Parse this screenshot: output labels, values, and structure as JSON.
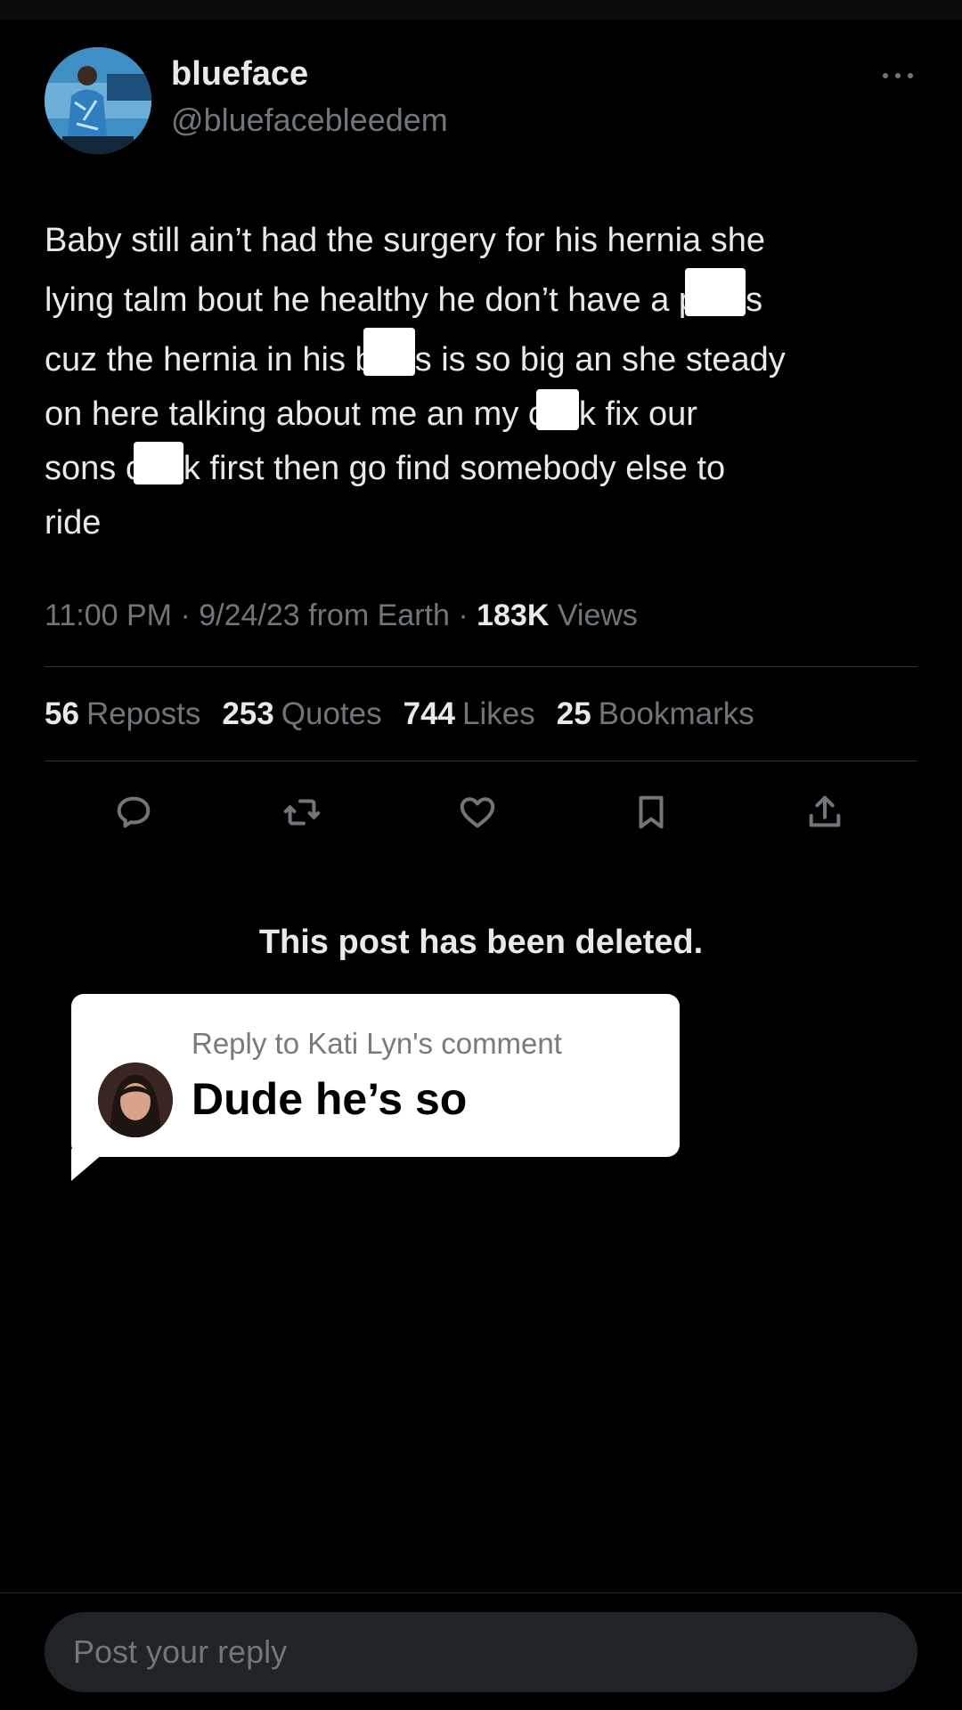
{
  "post": {
    "display_name": "blueface",
    "handle": "@bluefacebleedem",
    "text_lines": [
      "Baby still ain’t had the surgery for his hernia she",
      "lying talm bout he healthy he don’t have a p",
      "s",
      "cuz the hernia in his b",
      "s is so big an she steady",
      "on here talking about me an my c",
      "k fix our",
      "sons c",
      "k first then go find somebody else to",
      "ride"
    ],
    "time": "11:00 PM",
    "date": "9/24/23",
    "source": "from Earth",
    "views_count": "183K",
    "views_label": "Views"
  },
  "stats": {
    "reposts_count": "56",
    "reposts_label": "Reposts",
    "quotes_count": "253",
    "quotes_label": "Quotes",
    "likes_count": "744",
    "likes_label": "Likes",
    "bookmarks_count": "25",
    "bookmarks_label": "Bookmarks"
  },
  "actions": [
    "reply-icon",
    "repost-icon",
    "like-icon",
    "bookmark-icon",
    "share-icon"
  ],
  "deleted_notice": "This post has been deleted.",
  "reply_bubble": {
    "subtitle": "Reply to Kati Lyn's comment",
    "text": "Dude he’s so"
  },
  "composer": {
    "placeholder": "Post your reply"
  },
  "colors": {
    "background": "#000000",
    "primary_text": "#e7e9ea",
    "secondary_text": "#71767b",
    "divider": "#2f3336",
    "composer_bg": "#202327",
    "bubble_bg": "#ffffff"
  }
}
